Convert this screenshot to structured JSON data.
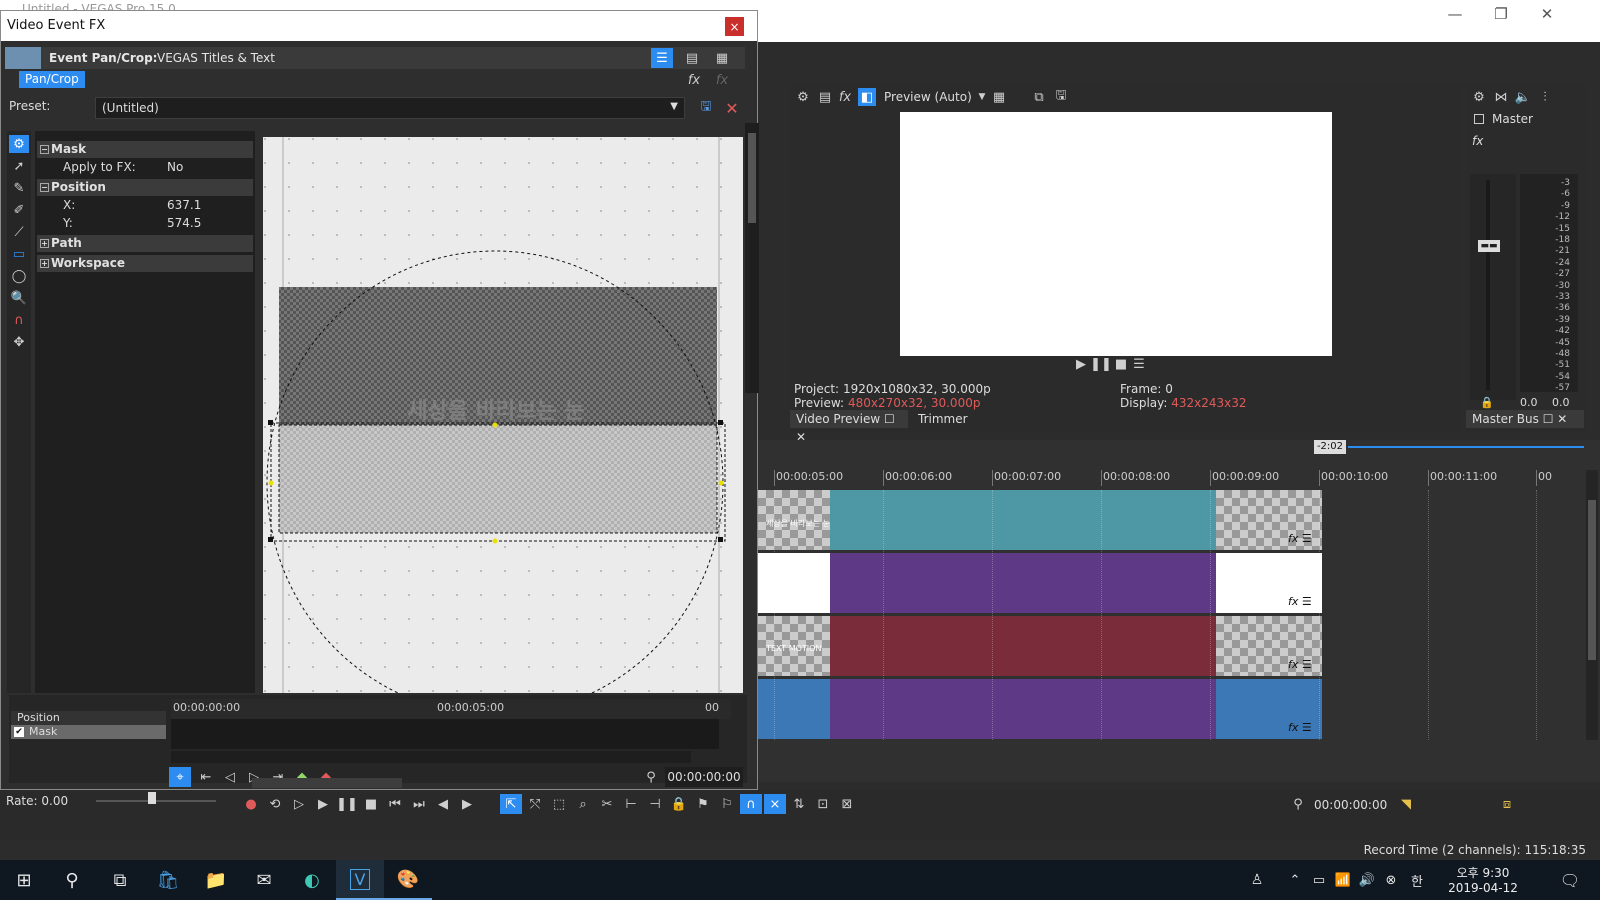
{
  "app": {
    "title": "Untitled - VEGAS Pro 15.0"
  },
  "fx": {
    "window_title": "Video Event FX",
    "close": "×",
    "event_label": "Event Pan/Crop:",
    "plugin_name": "VEGAS Titles & Text",
    "tab": "Pan/Crop",
    "preset_label": "Preset:",
    "preset_value": "(Untitled)",
    "props": {
      "mask": "Mask",
      "apply_fx_key": "Apply to FX:",
      "apply_fx_val": "No",
      "position": "Position",
      "x_key": "X:",
      "x_val": "637.1",
      "y_key": "Y:",
      "y_val": "574.5",
      "path": "Path",
      "workspace": "Workspace"
    },
    "canvas_text": "세상을 바라보는 눈",
    "kf_tracks": [
      "Position",
      "Mask"
    ],
    "kf_ruler": [
      "00:00:00:00",
      "00:00:05:00",
      "00"
    ],
    "kf_time": "00:00:00:00"
  },
  "preview": {
    "mode": "Preview (Auto)",
    "project_label": "Project:",
    "project_val": "1920x1080x32, 30.000p",
    "preview_label": "Preview:",
    "preview_val": "480x270x32, 30.000p",
    "frame_label": "Frame:",
    "frame_val": "0",
    "display_label": "Display:",
    "display_val": "432x243x32",
    "tab_video_preview": "Video Preview",
    "tab_trimmer": "Trimmer"
  },
  "master": {
    "label": "Master",
    "scale": [
      "3",
      "6",
      "9",
      "12",
      "15",
      "18",
      "21",
      "24",
      "27",
      "30",
      "33",
      "36",
      "39",
      "42",
      "45",
      "48",
      "51",
      "54",
      "57"
    ],
    "left_val": "0.0",
    "right_val": "0.0",
    "tab": "Master Bus"
  },
  "timeline": {
    "marker": "-2:02",
    "ruler": [
      "00:00:05:00",
      "00:00:06:00",
      "00:00:07:00",
      "00:00:08:00",
      "00:00:09:00",
      "00:00:10:00",
      "00:00:11:00",
      "00"
    ],
    "tracks": [
      {
        "color": "#4e98a6",
        "label": "세상을 바라보는 눈"
      },
      {
        "color": "#5e3a86",
        "label": ""
      },
      {
        "color": "#7a2c3a",
        "label": "TEXT MOTION"
      },
      {
        "color": "#5e3a86",
        "label": ""
      }
    ]
  },
  "transport": {
    "rate": "Rate: 0.00",
    "time": "00:00:00:00",
    "record_time": "Record Time (2 channels): 115:18:35"
  },
  "taskbar": {
    "time": "오후 9:30",
    "date": "2019-04-12",
    "ime": "한"
  }
}
